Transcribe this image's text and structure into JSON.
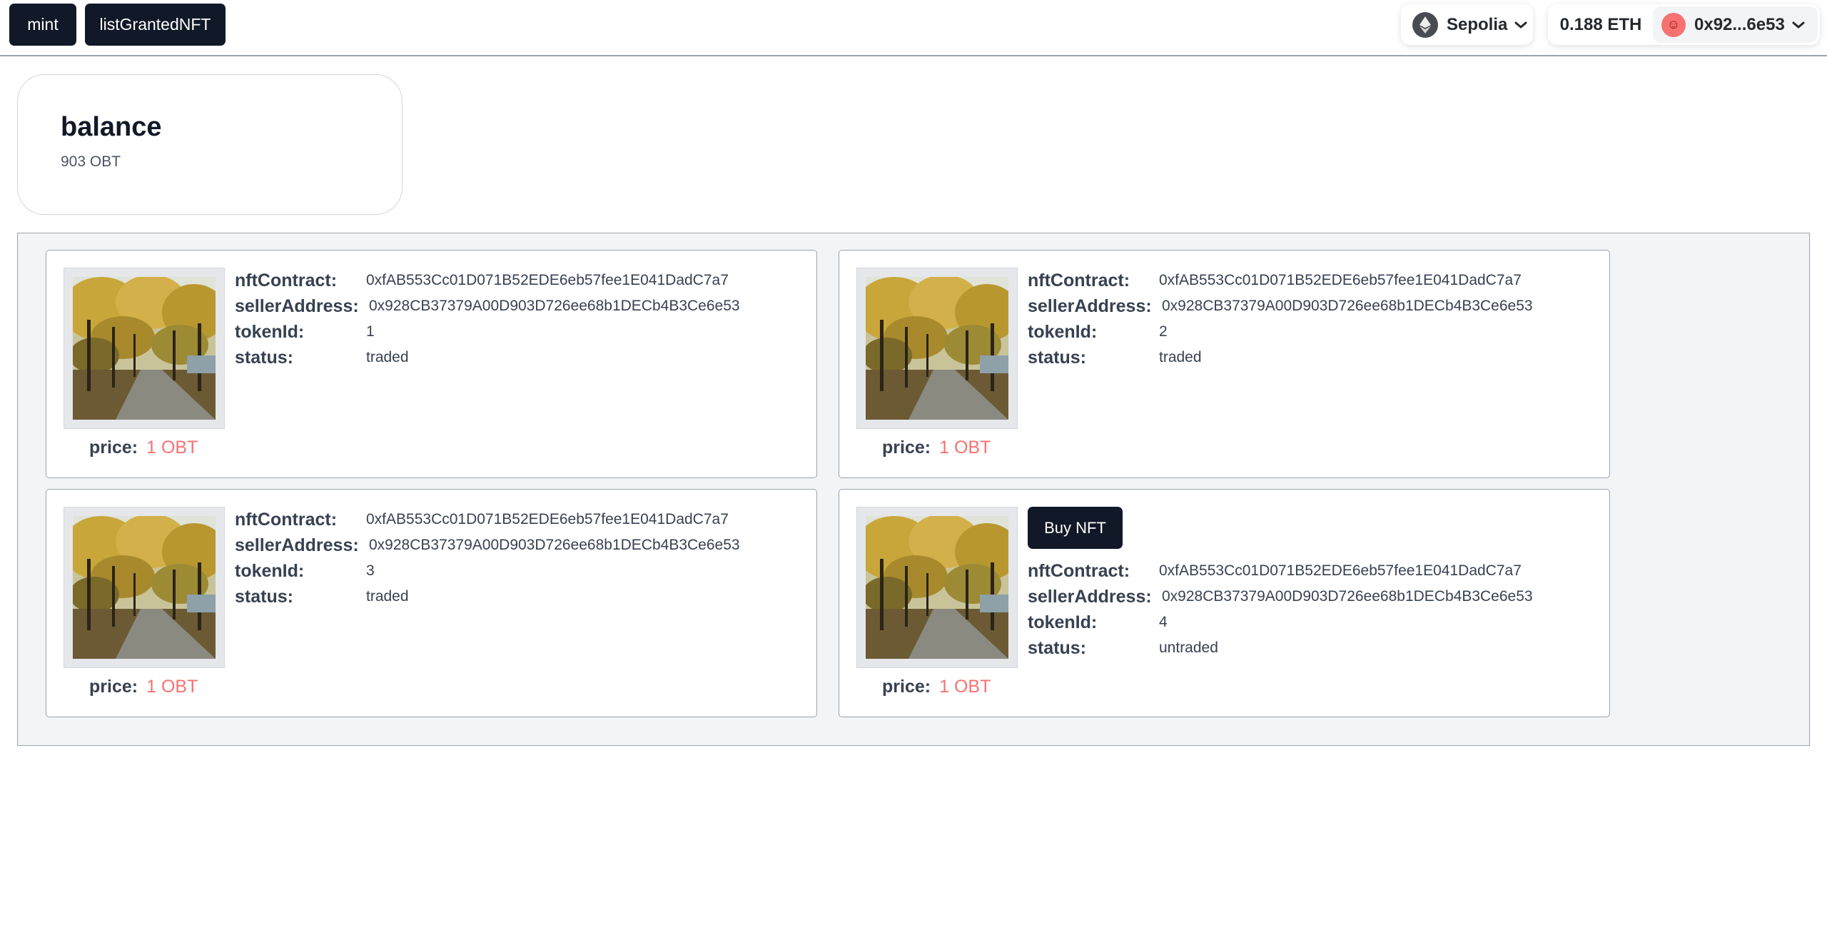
{
  "nav": {
    "mint_label": "mint",
    "list_label": "listGrantedNFT"
  },
  "wallet": {
    "network": "Sepolia",
    "network_icon": "ethereum-icon",
    "balance": "0.188 ETH",
    "address": "0x92...6e53",
    "avatar_icon": "avatar-emoji-icon"
  },
  "balance_card": {
    "title": "balance",
    "value": "903 OBT"
  },
  "labels": {
    "nft_contract": "nftContract:",
    "seller_address": "sellerAddress:",
    "token_id": "tokenId:",
    "status": "status:",
    "price": "price",
    "price_colon": ":",
    "buy": "Buy NFT"
  },
  "nfts": [
    {
      "nft_contract": "0xfAB553Cc01D071B52EDE6eb57fee1E041DadC7a7",
      "seller_address": "0x928CB37379A00D903D726ee68b1DECb4B3Ce6e53",
      "token_id": "1",
      "status": "traded",
      "price": "1 OBT"
    },
    {
      "nft_contract": "0xfAB553Cc01D071B52EDE6eb57fee1E041DadC7a7",
      "seller_address": "0x928CB37379A00D903D726ee68b1DECb4B3Ce6e53",
      "token_id": "2",
      "status": "traded",
      "price": "1 OBT"
    },
    {
      "nft_contract": "0xfAB553Cc01D071B52EDE6eb57fee1E041DadC7a7",
      "seller_address": "0x928CB37379A00D903D726ee68b1DECb4B3Ce6e53",
      "token_id": "3",
      "status": "traded",
      "price": "1 OBT"
    },
    {
      "nft_contract": "0xfAB553Cc01D071B52EDE6eb57fee1E041DadC7a7",
      "seller_address": "0x928CB37379A00D903D726ee68b1DECb4B3Ce6e53",
      "token_id": "4",
      "status": "untraded",
      "price": "1 OBT"
    }
  ],
  "colors": {
    "nav_bg": "#111827",
    "price": "#f87171",
    "market_bg": "#f3f4f6"
  }
}
